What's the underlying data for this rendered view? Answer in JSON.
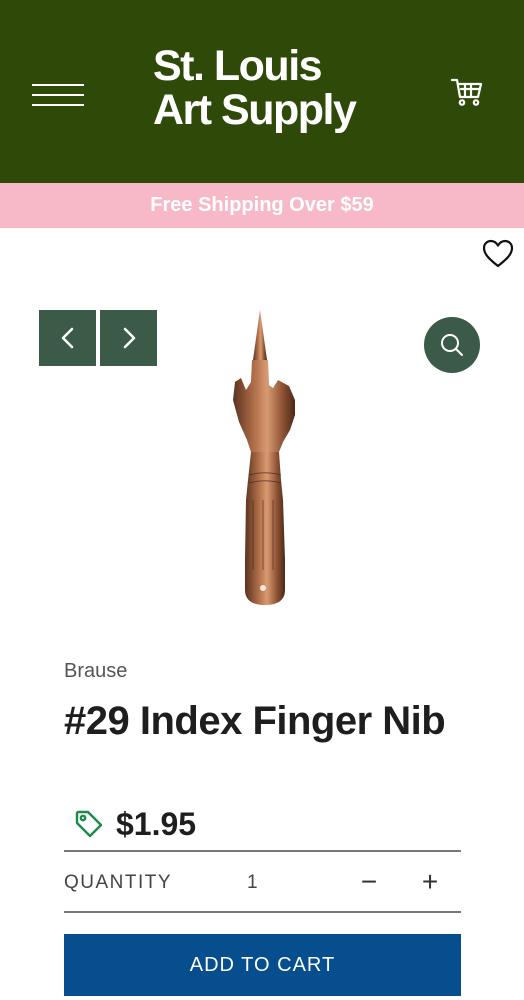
{
  "header": {
    "logo_line1": "St. Louis",
    "logo_line2": "Art Supply",
    "menu_icon": "hamburger-icon",
    "cart_icon": "cart-icon",
    "background_color": "#2f4a08"
  },
  "promo": {
    "text": "Free Shipping Over $59",
    "background_color": "#f7b9c8"
  },
  "gallery": {
    "wishlist_icon": "heart-icon",
    "prev_icon": "chevron-left-icon",
    "next_icon": "chevron-right-icon",
    "zoom_icon": "search-icon",
    "accent_color": "#3c5a48"
  },
  "product": {
    "brand": "Brause",
    "title": "#29 Index Finger Nib",
    "price": "$1.95",
    "price_icon": "price-tag-icon"
  },
  "quantity": {
    "label": "QUANTITY",
    "value": "1",
    "minus": "−",
    "plus": "+"
  },
  "cart_button": {
    "label": "ADD TO CART",
    "color": "#064e8e"
  }
}
